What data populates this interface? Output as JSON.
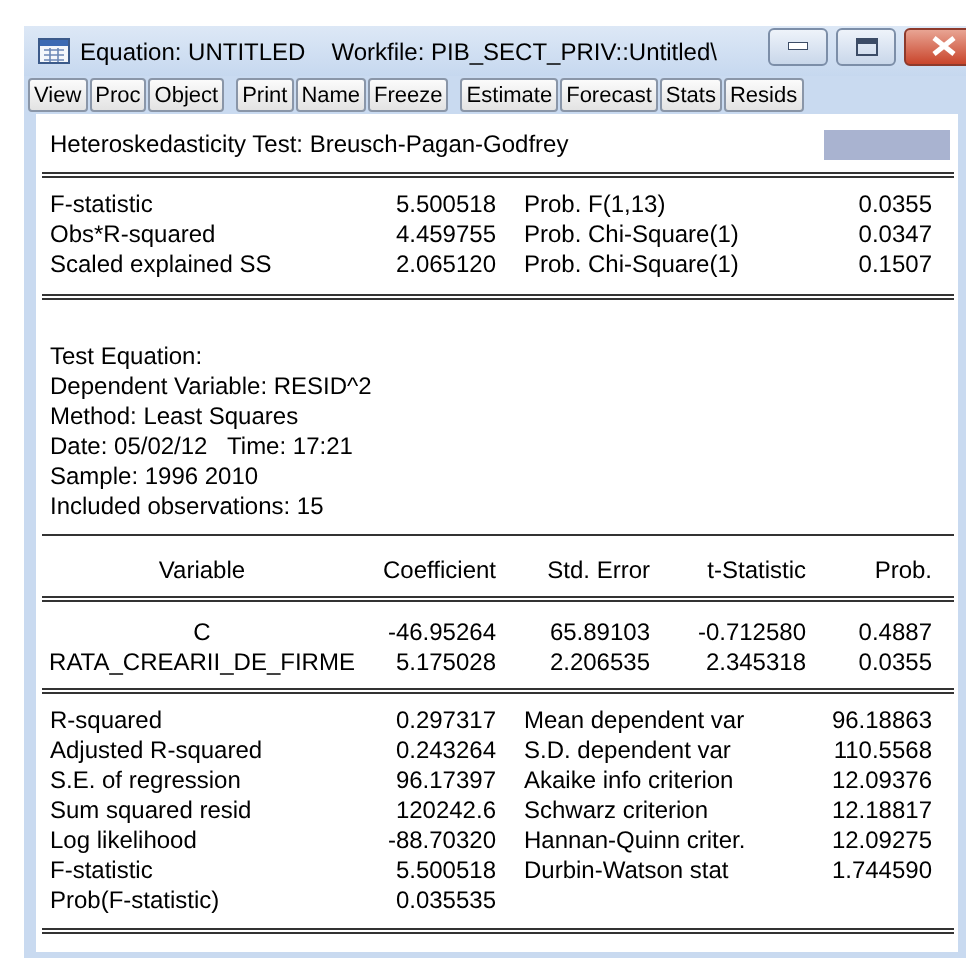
{
  "window": {
    "title": "Equation: UNTITLED",
    "workfile": "Workfile: PIB_SECT_PRIV::Untitled\\"
  },
  "toolbar": [
    [
      "View",
      "Proc",
      "Object"
    ],
    [
      "Print",
      "Name",
      "Freeze"
    ],
    [
      "Estimate",
      "Forecast",
      "Stats",
      "Resids"
    ]
  ],
  "test": {
    "title": "Heteroskedasticity Test: Breusch-Pagan-Godfrey",
    "rows": [
      {
        "label": "F-statistic",
        "value": "5.500518",
        "prob_label": "Prob. F(1,13)",
        "prob": "0.0355"
      },
      {
        "label": "Obs*R-squared",
        "value": "4.459755",
        "prob_label": "Prob. Chi-Square(1)",
        "prob": "0.0347"
      },
      {
        "label": "Scaled explained SS",
        "value": "2.065120",
        "prob_label": "Prob. Chi-Square(1)",
        "prob": "0.1507"
      }
    ]
  },
  "equation_info": [
    "Test Equation:",
    "Dependent Variable: RESID^2",
    "Method: Least Squares",
    "Date: 05/02/12   Time: 17:21",
    "Sample: 1996 2010",
    "Included observations: 15"
  ],
  "coefficients": {
    "columns": [
      "Variable",
      "Coefficient",
      "Std. Error",
      "t-Statistic",
      "Prob."
    ],
    "rows": [
      [
        "C",
        "-46.95264",
        "65.89103",
        "-0.712580",
        "0.4887"
      ],
      [
        "RATA_CREARII_DE_FIRME",
        "5.175028",
        "2.206535",
        "2.345318",
        "0.0355"
      ]
    ]
  },
  "summary": [
    {
      "label": "R-squared",
      "value": "0.297317",
      "label_2": "Mean dependent var",
      "value_2": "96.18863"
    },
    {
      "label": "Adjusted R-squared",
      "value": "0.243264",
      "label_2": "S.D. dependent var",
      "value_2": "110.5568"
    },
    {
      "label": "S.E. of regression",
      "value": "96.17397",
      "label_2": "Akaike info criterion",
      "value_2": "12.09376"
    },
    {
      "label": "Sum squared resid",
      "value": "120242.6",
      "label_2": "Schwarz criterion",
      "value_2": "12.18817"
    },
    {
      "label": "Log likelihood",
      "value": "-88.70320",
      "label_2": "Hannan-Quinn criter.",
      "value_2": "12.09275"
    },
    {
      "label": "F-statistic",
      "value": "5.500518",
      "label_2": "Durbin-Watson stat",
      "value_2": "1.744590"
    },
    {
      "label": "Prob(F-statistic)",
      "value": "0.035535"
    }
  ]
}
